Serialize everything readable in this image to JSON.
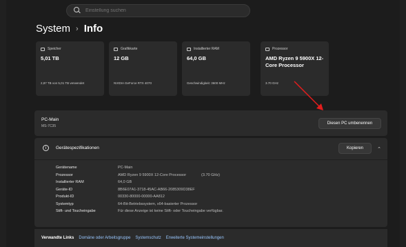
{
  "search": {
    "placeholder": "Einstellung suchen"
  },
  "header": {
    "crumb_parent": "System",
    "separator": "›",
    "crumb_current": "Info"
  },
  "cards": [
    {
      "icon": "storage-icon",
      "label": "Speicher",
      "value": "5,01 TB",
      "sub": "2,87 TB von 5,01 TB verwendet"
    },
    {
      "icon": "gpu-icon",
      "label": "Grafikkarte",
      "value": "12 GB",
      "sub": "NVIDIA GeForce RTX 4070"
    },
    {
      "icon": "ram-icon",
      "label": "Installierter RAM",
      "value": "64,0 GB",
      "sub": "Geschwindigkeit: 3600 MHz"
    },
    {
      "icon": "processor-icon",
      "label": "Prozessor",
      "value": "AMD Ryzen 9 5900X 12-Core Processor",
      "sub": "3.70 GHz"
    }
  ],
  "pc": {
    "name": "PC-Main",
    "model": "MS-7C35",
    "rename_label": "Diesen PC umbenennen"
  },
  "specs": {
    "title": "Gerätespezifikationen",
    "copy_label": "Kopieren",
    "rows": [
      {
        "key": "Gerätename",
        "value": "PC-Main",
        "extra": ""
      },
      {
        "key": "Prozessor",
        "value": "AMD Ryzen 9 5900X 12-Core Processor",
        "extra": "(3.70 GHz)"
      },
      {
        "key": "Installierter RAM",
        "value": "64,0 GB",
        "extra": ""
      },
      {
        "key": "Geräte-ID",
        "value": "8B6E07A1-3718-45AC-AB66-2085309D38EF",
        "extra": ""
      },
      {
        "key": "Produkt-ID",
        "value": "00330-80000-00000-AA812",
        "extra": ""
      },
      {
        "key": "Systemtyp",
        "value": "64-Bit-Betriebssystem, x64-basierter Prozessor",
        "extra": ""
      },
      {
        "key": "Stift- und Toucheingabe",
        "value": "Für diese Anzeige ist keine Stift- oder Toucheingabe verfügbar.",
        "extra": ""
      }
    ]
  },
  "related": {
    "label": "Verwandte Links",
    "links": [
      "Domäne oder Arbeitsgruppe",
      "Systemschutz",
      "Erweiterte Systemeinstellungen"
    ]
  },
  "colors": {
    "background": "#202020",
    "card": "#2b2b2b",
    "link": "#99c7ff",
    "annotation_arrow": "#e21d1d"
  }
}
